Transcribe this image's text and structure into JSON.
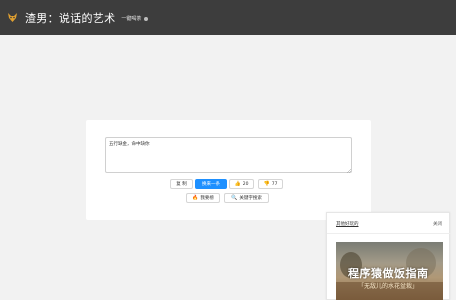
{
  "header": {
    "title": "渣男：说话的艺术",
    "subtitle": "一键喝茶",
    "logo_icon": "fox-icon",
    "background": "#3d3d3d"
  },
  "editor": {
    "text": "五行缺金，命中缺你"
  },
  "actions": {
    "copy_label": "复 制",
    "next_label": "换来一条",
    "like_count": "20",
    "dislike_count": "77",
    "hot_label": "我要榜",
    "search_label": "关键字搜索",
    "accent_color": "#1e90ff"
  },
  "popup": {
    "title": "其他好玩的",
    "close_label": "关闭",
    "book_title": "程序猿做饭指南",
    "book_subtitle": "「无敌儿的水花盆栽」"
  }
}
